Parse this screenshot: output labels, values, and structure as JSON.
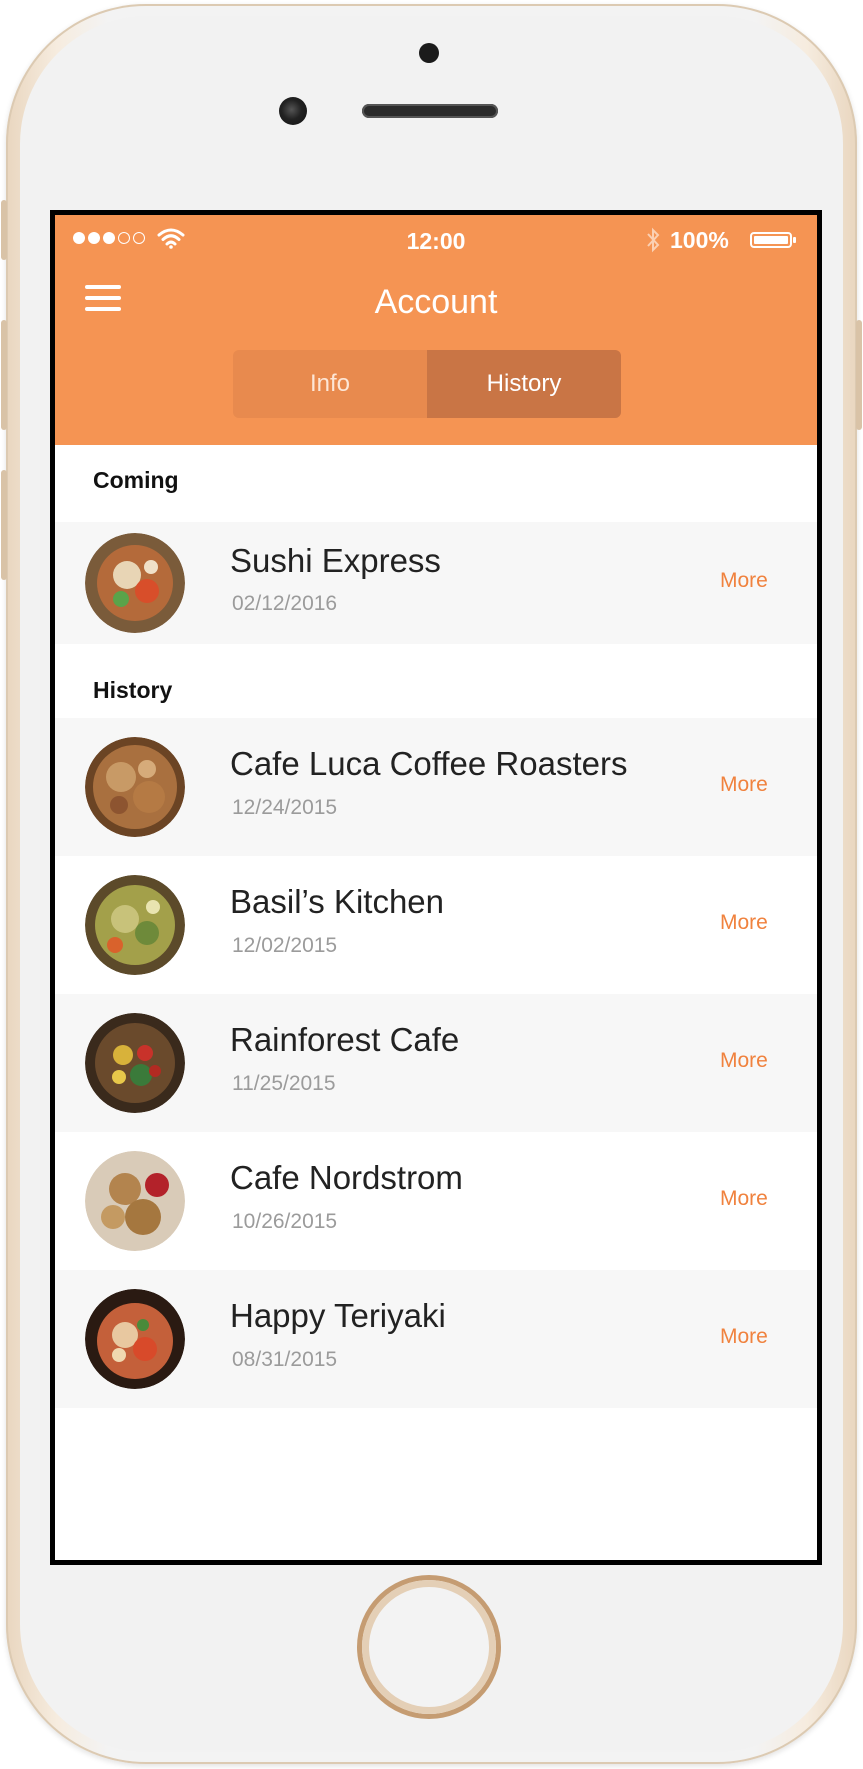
{
  "status_bar": {
    "time": "12:00",
    "battery": "100%"
  },
  "header": {
    "title": "Account",
    "tabs": [
      {
        "label": "Info",
        "active": false
      },
      {
        "label": "History",
        "active": true
      }
    ]
  },
  "sections": [
    {
      "title": "Coming",
      "items": [
        {
          "name": "Sushi Express",
          "date": "02/12/2016",
          "action": "More"
        }
      ]
    },
    {
      "title": "History",
      "items": [
        {
          "name": "Cafe Luca Coffee Roasters",
          "date": "12/24/2015",
          "action": "More"
        },
        {
          "name": "Basil’s Kitchen",
          "date": "12/02/2015",
          "action": "More"
        },
        {
          "name": "Rainforest Cafe",
          "date": "11/25/2015",
          "action": "More"
        },
        {
          "name": "Cafe Nordstrom",
          "date": "10/26/2015",
          "action": "More"
        },
        {
          "name": "Happy Teriyaki",
          "date": "08/31/2015",
          "action": "More"
        }
      ]
    }
  ],
  "colors": {
    "accent": "#f59453",
    "tab_active": "#c97545",
    "more_link": "#f0823e"
  }
}
